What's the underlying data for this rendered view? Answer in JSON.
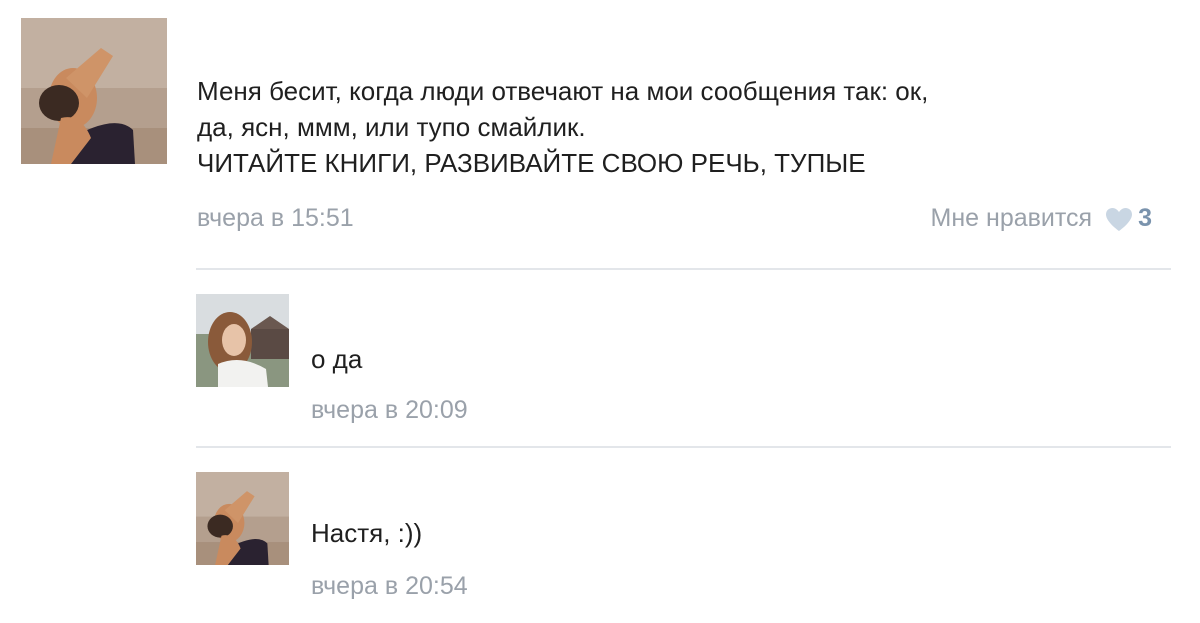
{
  "post": {
    "lines": [
      "Меня бесит, когда люди отвечают на мои сообщения так: ок,",
      "да, ясн, ммм, или тупо смайлик.",
      "ЧИТАЙТЕ КНИГИ, РАЗВИВАЙТЕ СВОЮ РЕЧЬ, ТУПЫЕ"
    ],
    "time": "вчера в 15:51",
    "like_label": "Мне нравится",
    "like_icon": "heart-icon",
    "like_count": "3"
  },
  "replies": [
    {
      "text": "о да",
      "time": "вчера в 20:09"
    },
    {
      "text": "Настя, :))",
      "time": "вчера в 20:54"
    }
  ],
  "colors": {
    "text": "#1f1f1f",
    "meta": "#9aa1aa",
    "like_count": "#7a93ad",
    "heart": "#c9d6e3",
    "divider": "#e3e6ea"
  }
}
